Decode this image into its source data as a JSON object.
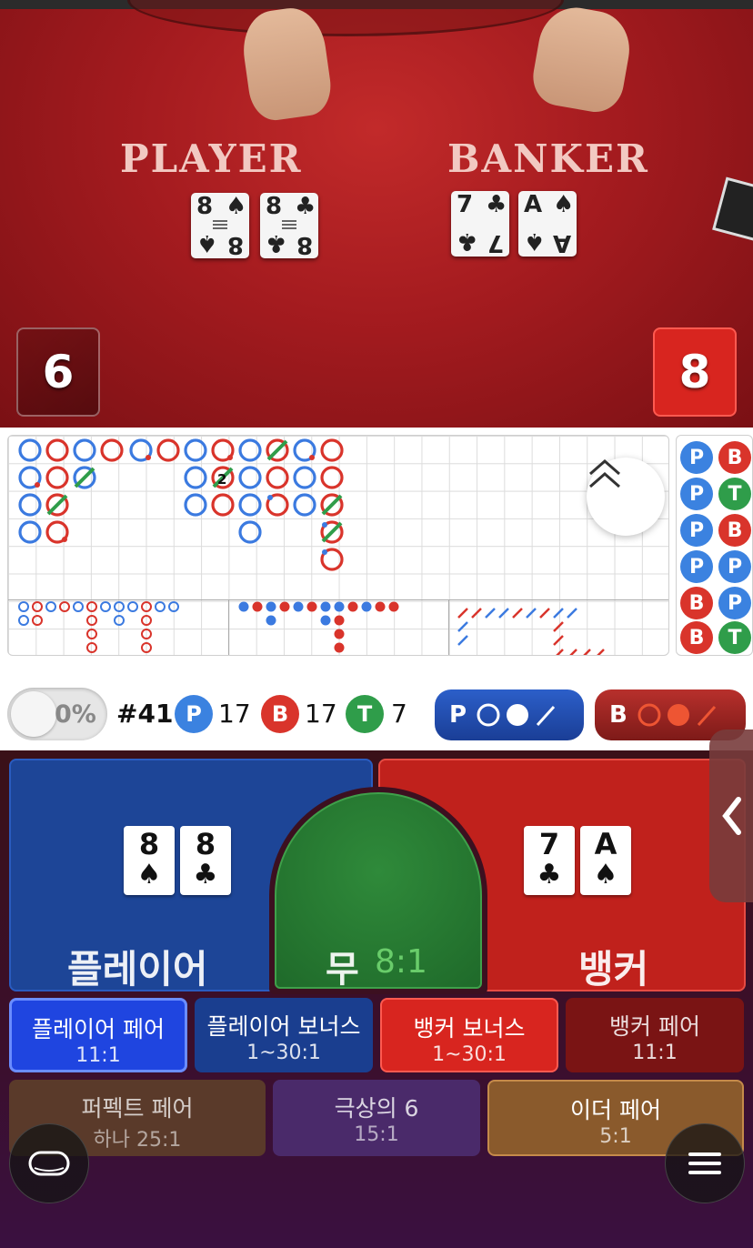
{
  "video": {
    "player_label": "PLAYER",
    "banker_label": "BANKER",
    "player_cards": [
      {
        "rank": "8",
        "suit": "♠"
      },
      {
        "rank": "8",
        "suit": "♣"
      }
    ],
    "banker_cards": [
      {
        "rank": "7",
        "suit": "♣"
      },
      {
        "rank": "A",
        "suit": "♠"
      }
    ],
    "player_score": "6",
    "banker_score": "8"
  },
  "roadmap": {
    "side_predictions": [
      [
        "P",
        "B"
      ],
      [
        "P",
        "T"
      ],
      [
        "P",
        "B"
      ],
      [
        "P",
        "P"
      ],
      [
        "B",
        "P"
      ],
      [
        "B",
        "T"
      ]
    ],
    "annotation": "2"
  },
  "stats": {
    "toggle_pct": "0%",
    "shoe_number": "#41",
    "player_label": "P",
    "player_count": "17",
    "banker_label": "B",
    "banker_count": "17",
    "tie_label": "T",
    "tie_count": "7",
    "predict_player": "P",
    "predict_banker": "B"
  },
  "bets": {
    "player": {
      "label": "플레이어",
      "cards": [
        {
          "rank": "8",
          "suit": "♠"
        },
        {
          "rank": "8",
          "suit": "♣"
        }
      ]
    },
    "tie": {
      "label": "무",
      "odds": "8:1"
    },
    "banker": {
      "label": "뱅커",
      "cards": [
        {
          "rank": "7",
          "suit": "♣"
        },
        {
          "rank": "A",
          "suit": "♠"
        }
      ]
    },
    "side": [
      {
        "name": "플레이어 페어",
        "odds": "11:1"
      },
      {
        "name": "플레이어 보너스",
        "odds": "1~30:1"
      },
      {
        "name": "뱅커 보너스",
        "odds": "1~30:1"
      },
      {
        "name": "뱅커 페어",
        "odds": "11:1"
      },
      {
        "name": "퍼펙트 페어",
        "odds": "하나 25:1"
      },
      {
        "name": "극상의 6",
        "odds": "15:1"
      },
      {
        "name": "이더 페어",
        "odds": "5:1"
      }
    ]
  },
  "colors": {
    "player": "#3b82e0",
    "banker": "#d9342b",
    "tie": "#2f9d4a"
  }
}
